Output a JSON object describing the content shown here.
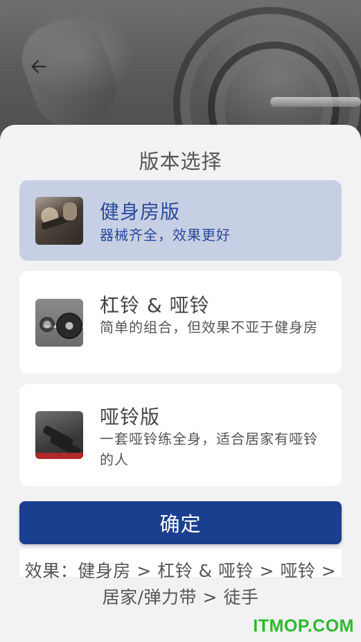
{
  "header": {
    "back_icon": "arrow-left-icon"
  },
  "sheet": {
    "title": "版本选择",
    "options": [
      {
        "title": "健身房版",
        "description": "器械齐全，效果更好",
        "selected": true,
        "thumb_icon": "gym-machine-photo"
      },
      {
        "title": "杠铃 & 哑铃",
        "description": "简单的组合，但效果不亚于健身房",
        "selected": false,
        "thumb_icon": "barbell-photo"
      },
      {
        "title": "哑铃版",
        "description": "一套哑铃练全身，适合居家有哑铃的人",
        "selected": false,
        "thumb_icon": "dumbbell-photo"
      }
    ],
    "confirm_label": "确定",
    "note": "效果：健身房 > 杠铃 & 哑铃 > 哑铃 > 居家/弹力带 > 徒手"
  },
  "watermark": "ITMOP.COM",
  "colors": {
    "accent": "#1a3f8f",
    "selected_card": "#c7cfe4",
    "selected_text": "#2a4a9a",
    "watermark": "#2db82d"
  }
}
